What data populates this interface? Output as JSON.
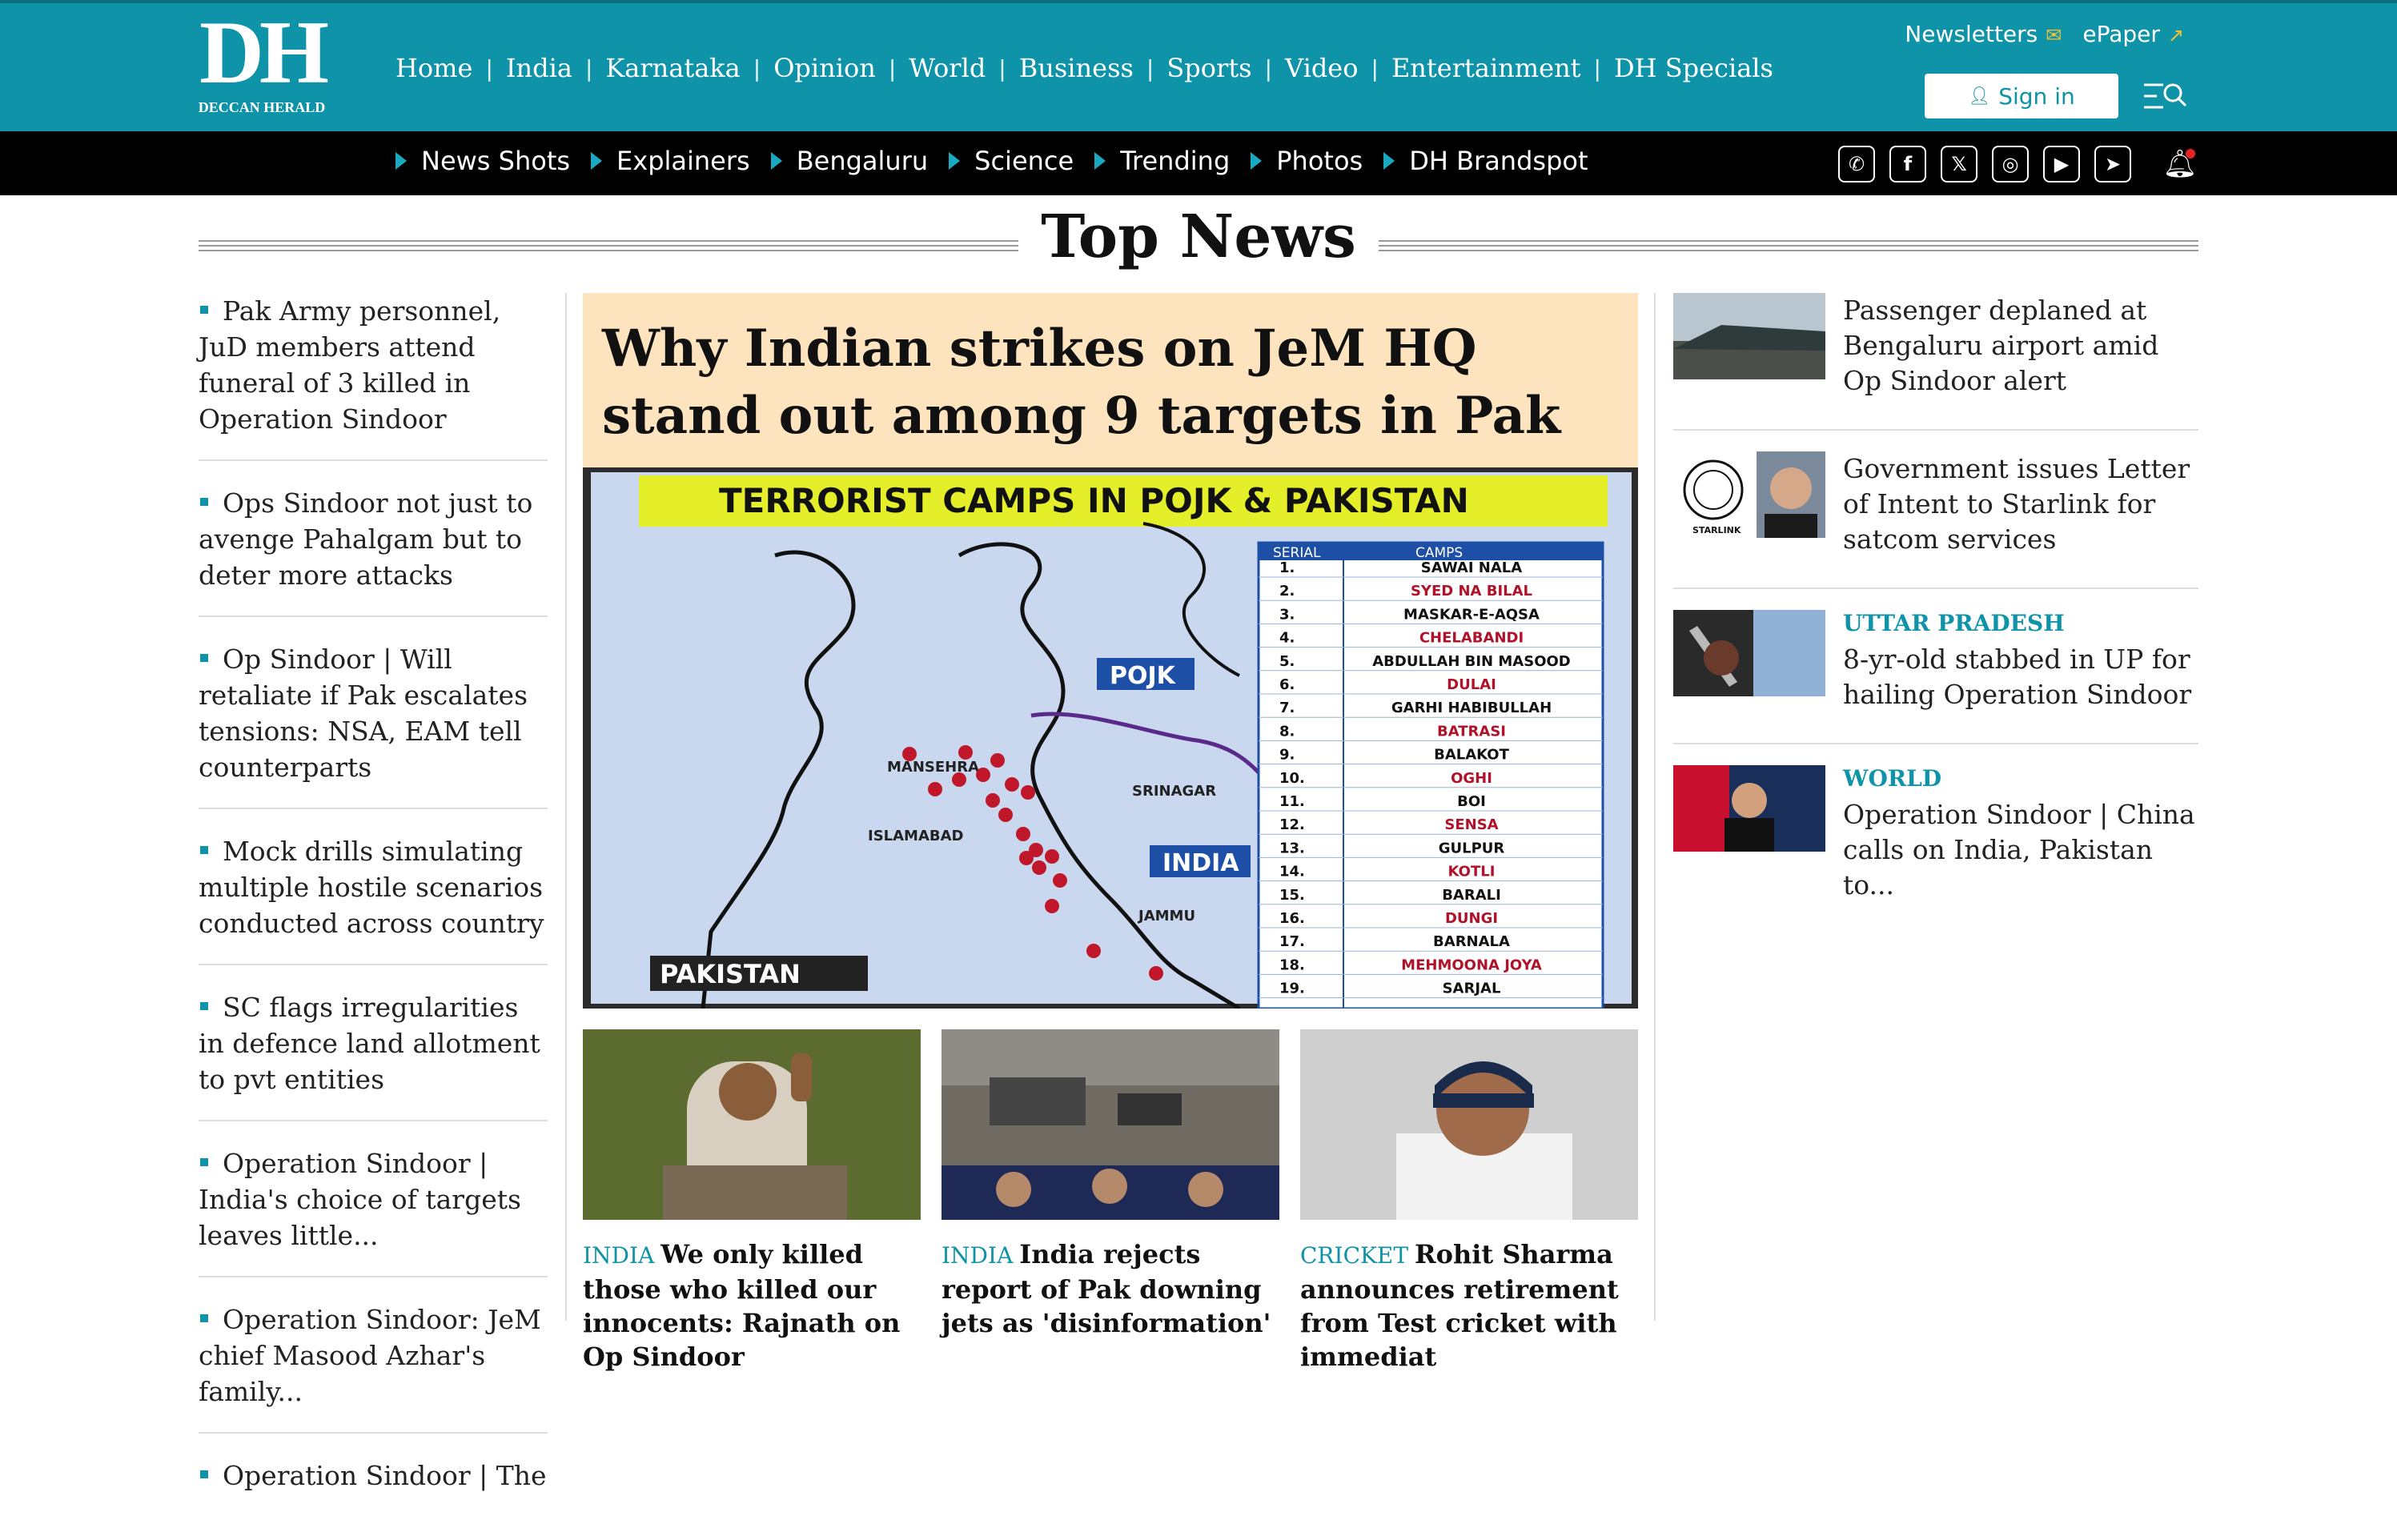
{
  "brand": {
    "logo_mark": "DH",
    "logo_sub": "DECCAN HERALD"
  },
  "colors": {
    "brand_teal": "#0e93a8",
    "hero_bg": "#fde4be",
    "subbar": "#000000"
  },
  "main_nav": [
    "Home",
    "India",
    "Karnataka",
    "Opinion",
    "World",
    "Business",
    "Sports",
    "Video",
    "Entertainment",
    "DH Specials"
  ],
  "utility": {
    "newsletters": "Newsletters",
    "epaper": "ePaper",
    "sign_in": "Sign in"
  },
  "sub_nav": [
    "News Shots",
    "Explainers",
    "Bengaluru",
    "Science",
    "Trending",
    "Photos",
    "DH Brandspot"
  ],
  "social": [
    "whatsapp-icon",
    "facebook-icon",
    "x-icon",
    "instagram-icon",
    "youtube-icon",
    "telegram-icon"
  ],
  "section": {
    "title": "Top News"
  },
  "left_list": [
    "Pak Army personnel, JuD members attend funeral of 3 killed in Operation Sindoor",
    "Ops Sindoor not just to avenge Pahalgam but to deter more attacks",
    "Op Sindoor | Will retaliate if Pak escalates tensions: NSA, EAM tell counterparts",
    "Mock drills simulating multiple hostile scenarios conducted across country",
    "SC flags irregularities in defence land allotment to pvt entities",
    "Operation Sindoor | India's choice of targets leaves little...",
    "Operation Sindoor: JeM chief Masood Azhar's family...",
    "Operation Sindoor | The"
  ],
  "hero": {
    "title": "Why Indian strikes on JeM HQ stand out among 9 targets in Pak",
    "image": {
      "banner": "TERRORIST CAMPS IN POJK & PAKISTAN",
      "labels": {
        "pojk": "POJK",
        "india": "INDIA",
        "pakistan": "PAKISTAN",
        "srinagar": "SRINAGAR",
        "islamabad": "ISLAMABAD",
        "mansehra": "MANSEHRA",
        "jammu": "JAMMU"
      },
      "table_head": [
        "SERIAL",
        "CAMPS"
      ],
      "camps": [
        "SAWAI NALA",
        "SYED NA BILAL",
        "MASKAR-E-AQSA",
        "CHELABANDI",
        "ABDULLAH BIN MASOOD",
        "DULAI",
        "GARHI HABIBULLAH",
        "BATRASI",
        "BALAKOT",
        "OGHI",
        "BOI",
        "SENSA",
        "GULPUR",
        "KOTLI",
        "BARALI",
        "DUNGI",
        "BARNALA",
        "MEHMOONA JOYA",
        "SARJAL"
      ]
    }
  },
  "cards": [
    {
      "cat": "INDIA",
      "title": "We only killed those who killed our innocents: Rajnath on Op Sindoor"
    },
    {
      "cat": "INDIA",
      "title": "India rejects report of Pak downing jets as 'disinformation'"
    },
    {
      "cat": "CRICKET",
      "title": "Rohit Sharma announces retirement from Test cricket with immediat"
    }
  ],
  "right_list": [
    {
      "cat": "",
      "title": "Passenger deplaned at Bengaluru airport amid Op Sindoor alert"
    },
    {
      "cat": "",
      "title": "Government issues Letter of Intent to Starlink for satcom services",
      "logo_text": "STARLINK"
    },
    {
      "cat": "UTTAR PRADESH",
      "title": "8-yr-old stabbed in UP for hailing Operation Sindoor"
    },
    {
      "cat": "WORLD",
      "title": "Operation Sindoor | China calls on India, Pakistan to..."
    }
  ]
}
